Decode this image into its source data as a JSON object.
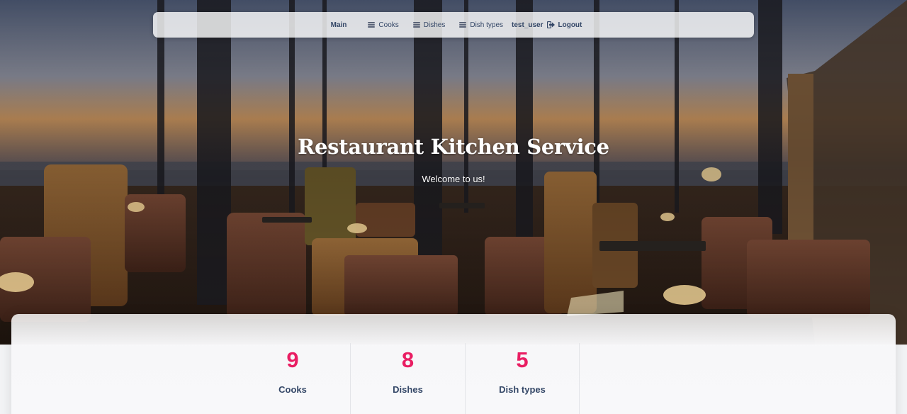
{
  "navbar": {
    "main_label": "Main",
    "cooks_label": "Cooks",
    "dishes_label": "Dishes",
    "dish_types_label": "Dish types",
    "username": "test_user",
    "logout_label": "Logout"
  },
  "hero": {
    "title": "Restaurant Kitchen Service",
    "subtitle": "Welcome to us!"
  },
  "stats": [
    {
      "value": "9",
      "label": "Cooks"
    },
    {
      "value": "8",
      "label": "Dishes"
    },
    {
      "value": "5",
      "label": "Dish types"
    }
  ],
  "colors": {
    "accent": "#e91e63",
    "text_dark": "#344767"
  },
  "icons": {
    "nav_list": "list-icon",
    "logout": "sign-out-icon"
  }
}
